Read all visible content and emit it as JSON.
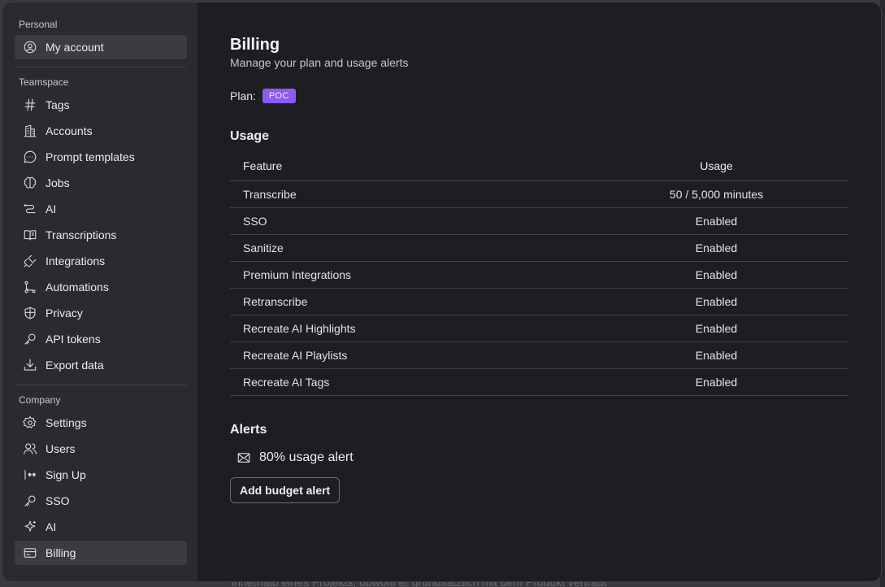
{
  "background_text": "innerhalb eines Projekts, obwohl er grundsätzlich mit dem Produkt vertraut",
  "sidebar": {
    "personal_label": "Personal",
    "personal_items": [
      {
        "label": "My account",
        "icon": "user-circle-icon",
        "active": true
      }
    ],
    "teamspace_label": "Teamspace",
    "teamspace_items": [
      {
        "label": "Tags",
        "icon": "hash-icon"
      },
      {
        "label": "Accounts",
        "icon": "building-icon"
      },
      {
        "label": "Prompt templates",
        "icon": "chat-bubble-icon"
      },
      {
        "label": "Jobs",
        "icon": "brain-icon"
      },
      {
        "label": "AI",
        "icon": "route-icon"
      },
      {
        "label": "Transcriptions",
        "icon": "book-open-icon"
      },
      {
        "label": "Integrations",
        "icon": "plug-icon"
      },
      {
        "label": "Automations",
        "icon": "git-branch-icon"
      },
      {
        "label": "Privacy",
        "icon": "shield-icon"
      },
      {
        "label": "API tokens",
        "icon": "key-icon"
      },
      {
        "label": "Export data",
        "icon": "download-tray-icon"
      }
    ],
    "company_label": "Company",
    "company_items": [
      {
        "label": "Settings",
        "icon": "gear-icon"
      },
      {
        "label": "Users",
        "icon": "users-icon"
      },
      {
        "label": "Sign Up",
        "icon": "password-cursor-icon"
      },
      {
        "label": "SSO",
        "icon": "key-icon"
      },
      {
        "label": "AI",
        "icon": "sparkle-icon"
      },
      {
        "label": "Billing",
        "icon": "credit-card-icon",
        "active": true
      }
    ]
  },
  "main": {
    "title": "Billing",
    "subtitle": "Manage your plan and usage alerts",
    "plan_label": "Plan:",
    "plan_badge": "POC",
    "plan_badge_color": "#8a5cf0",
    "usage_heading": "Usage",
    "table": {
      "headers": [
        "Feature",
        "Usage"
      ],
      "rows": [
        [
          "Transcribe",
          "50 / 5,000 minutes"
        ],
        [
          "SSO",
          "Enabled"
        ],
        [
          "Sanitize",
          "Enabled"
        ],
        [
          "Premium Integrations",
          "Enabled"
        ],
        [
          "Retranscribe",
          "Enabled"
        ],
        [
          "Recreate AI Highlights",
          "Enabled"
        ],
        [
          "Recreate AI Playlists",
          "Enabled"
        ],
        [
          "Recreate AI Tags",
          "Enabled"
        ]
      ]
    },
    "alerts_heading": "Alerts",
    "alert_item": "80% usage alert",
    "add_button": "Add budget alert"
  }
}
